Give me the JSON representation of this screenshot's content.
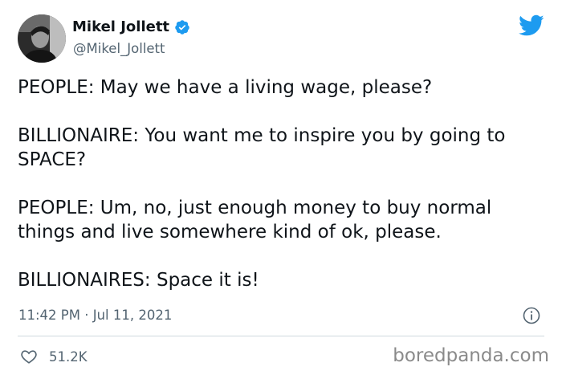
{
  "author": {
    "display_name": "Mikel Jollett",
    "handle": "@Mikel_Jollett",
    "verified": true,
    "avatar_icon": "profile-photo"
  },
  "tweet": {
    "text": "PEOPLE: May we have a living wage, please?\n\nBILLIONAIRE: You want me to inspire you by going to SPACE?\n\nPEOPLE: Um, no, just enough money to buy normal things and live somewhere kind of ok, please.\n\nBILLIONAIRES: Space it is!",
    "timestamp": "11:42 PM · Jul 11, 2021"
  },
  "actions": {
    "likes_count": "51.2K",
    "like_icon": "heart-icon",
    "info_icon": "info-icon"
  },
  "brand": {
    "icon": "twitter-bird-icon",
    "color": "#1d9bf0"
  },
  "watermark": {
    "text": "boredpanda.com"
  }
}
